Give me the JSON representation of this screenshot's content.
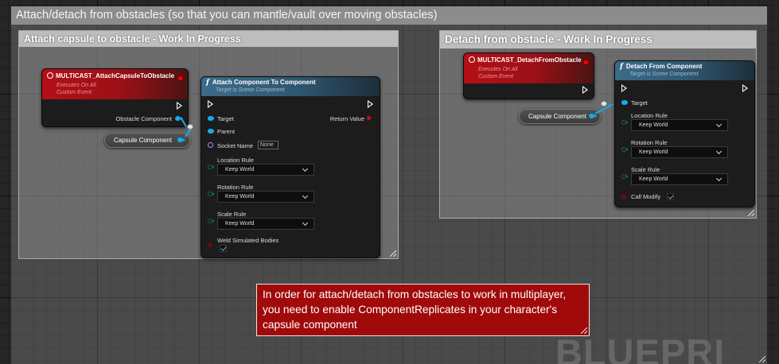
{
  "outer_comment": {
    "title": "Attach/detach from obstacles  (so that you can mantle/vault over moving obstacles)"
  },
  "attach_comment": {
    "title": "Attach capsule to obstacle - Work In Progress"
  },
  "detach_comment": {
    "title": "Detach from obstacle - Work In Progress"
  },
  "attach_event": {
    "title": "MULTICAST_AttachCapsuleToObstacle",
    "subtitle1": "Executes On All",
    "subtitle2": "Custom Event",
    "output_pin": "Obstacle Component"
  },
  "attach_var": {
    "label": "Capsule Component"
  },
  "attach_function": {
    "title": "Attach Component To Component",
    "subtitle": "Target is Scene Component",
    "pins": {
      "target": "Target",
      "parent": "Parent",
      "socket": "Socket Name",
      "socket_value": "None",
      "location_rule": "Location Rule",
      "location_value": "Keep World",
      "rotation_rule": "Rotation Rule",
      "rotation_value": "Keep World",
      "scale_rule": "Scale Rule",
      "scale_value": "Keep World",
      "weld": "Weld Simulated Bodies",
      "return_value": "Return Value"
    },
    "weld_checked": true
  },
  "detach_event": {
    "title": "MULTICAST_DetachFromObstacle",
    "subtitle1": "Executes On All",
    "subtitle2": "Custom Event"
  },
  "detach_var": {
    "label": "Capsule Component"
  },
  "detach_function": {
    "title": "Detach From Component",
    "subtitle": "Target is Scene Component",
    "pins": {
      "target": "Target",
      "location_rule": "Location Rule",
      "location_value": "Keep World",
      "rotation_rule": "Rotation Rule",
      "rotation_value": "Keep World",
      "scale_rule": "Scale Rule",
      "scale_value": "Keep World",
      "call_modify": "Call Modify"
    },
    "call_modify_checked": true
  },
  "note": {
    "text": "In order for attach/detach from obstacles to work in multiplayer, you need to enable ComponentReplicates in your character's capsule component"
  },
  "watermark": {
    "text": "BLUEPRI"
  },
  "colors": {
    "event_header": "#b40f17",
    "function_header": "#3c6b8a",
    "object_pin": "#19a9ee",
    "struct_pin": "#0b6b55",
    "name_pin": "#c47cf0",
    "note_bg": "#a00a0a"
  }
}
